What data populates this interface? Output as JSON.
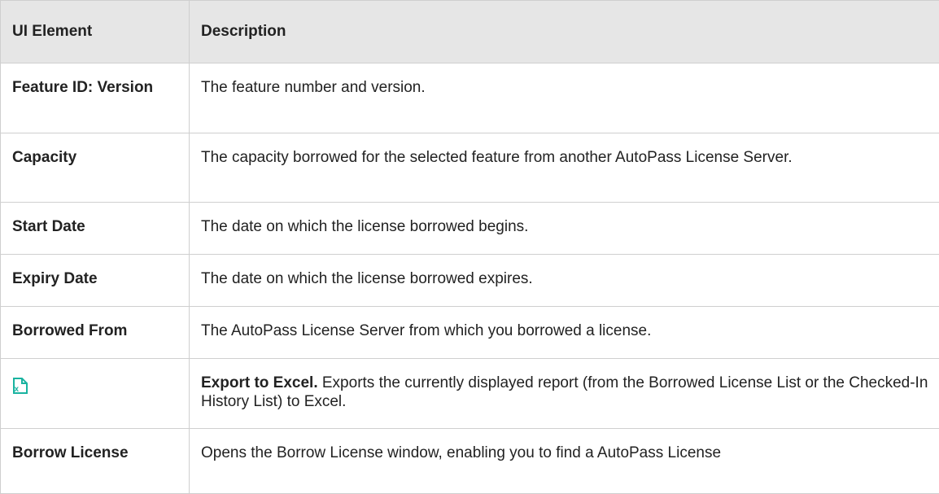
{
  "table": {
    "headers": {
      "element": "UI Element",
      "description": "Description"
    },
    "rows": [
      {
        "element": "Feature ID: Version",
        "description": "The feature number and version."
      },
      {
        "element": "Capacity",
        "description": "The capacity borrowed for the selected feature from another AutoPass License Server."
      },
      {
        "element": "Start Date",
        "description": "The date on which the license borrowed begins."
      },
      {
        "element": "Expiry Date",
        "description": "The date on which the license borrowed expires."
      },
      {
        "element": "Borrowed From",
        "description": "The AutoPass License Server from which you borrowed a license."
      },
      {
        "element_icon": "excel-export-icon",
        "description_strong": "Export to Excel.",
        "description": " Exports the currently displayed report (from the Borrowed License List or the Checked-In History List) to Excel."
      },
      {
        "element": "Borrow License",
        "description": "Opens the Borrow License window, enabling you to find a AutoPass License"
      }
    ]
  },
  "colors": {
    "header_bg": "#e6e6e6",
    "border": "#cfcfcf",
    "icon_teal": "#19b3a0"
  }
}
